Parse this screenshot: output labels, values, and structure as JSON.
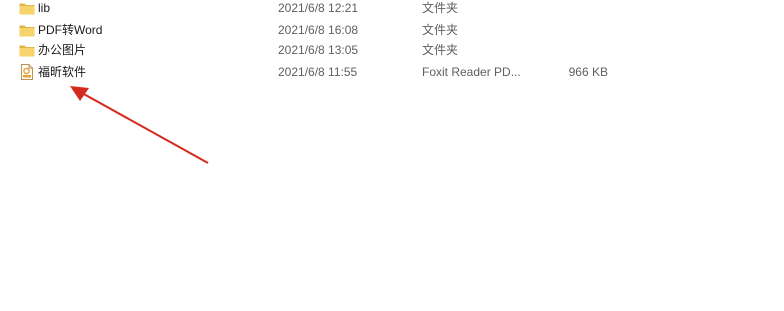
{
  "files": [
    {
      "name": "lib",
      "date": "2021/6/8 12:21",
      "type": "文件夹",
      "size": "",
      "icon": "folder-icon"
    },
    {
      "name": "PDF转Word",
      "date": "2021/6/8 16:08",
      "type": "文件夹",
      "size": "",
      "icon": "folder-icon"
    },
    {
      "name": "办公图片",
      "date": "2021/6/8 13:05",
      "type": "文件夹",
      "size": "",
      "icon": "folder-icon"
    },
    {
      "name": "福昕软件",
      "date": "2021/6/8 11:55",
      "type": "Foxit Reader PD...",
      "size": "966 KB",
      "icon": "pdf-file-icon"
    }
  ],
  "colors": {
    "folder": "#f7d36b",
    "folder_dark": "#e0b546",
    "arrow": "#d42a1e",
    "pdf_accent": "#e8a33d"
  },
  "annotation": {
    "icon": "red-arrow-icon"
  }
}
